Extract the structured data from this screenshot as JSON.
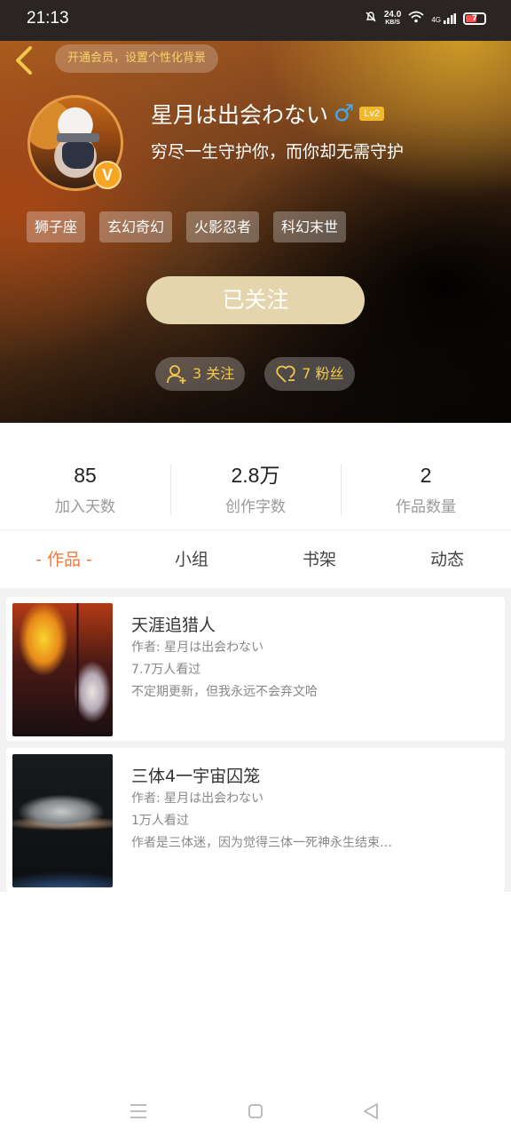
{
  "status_bar": {
    "time": "21:13",
    "speed_value": "24.0",
    "speed_unit": "KB/S",
    "network": "4G",
    "battery": "7"
  },
  "header": {
    "vip_text": "开通会员，设置个性化背景"
  },
  "profile": {
    "username": "星月は出会わない",
    "gender_symbol": "♂",
    "level": "Lv2",
    "verified_mark": "V",
    "signature": "穷尽一生守护你，而你却无需守护",
    "tags": [
      "狮子座",
      "玄幻奇幻",
      "火影忍者",
      "科幻末世"
    ],
    "follow_button": "已关注",
    "following_label": "3 关注",
    "fans_label": "7 粉丝"
  },
  "stats": [
    {
      "value": "85",
      "label": "加入天数"
    },
    {
      "value": "2.8万",
      "label": "创作字数"
    },
    {
      "value": "2",
      "label": "作品数量"
    }
  ],
  "tabs": [
    "- 作品 -",
    "小组",
    "书架",
    "动态"
  ],
  "active_tab": 0,
  "books": [
    {
      "title": "天涯追猎人",
      "author": "作者: 星月は出会わない",
      "views": "7.7万人看过",
      "description": "不定期更新，但我永远不会弃文哈"
    },
    {
      "title": "三体4一宇宙囚笼",
      "author": "作者: 星月は出会わない",
      "views": "1万人看过",
      "description": "作者是三体迷，因为觉得三体一死神永生结束…"
    }
  ],
  "colors": {
    "accent": "#f07a3c",
    "gold": "#f2c94c",
    "follow_button_bg": "#e5d5ad",
    "gender_blue": "#4aa8e8"
  },
  "icons": [
    "back-arrow-icon",
    "person-add-icon",
    "heart-icon",
    "menu-icon",
    "home-square-icon",
    "back-triangle-icon"
  ]
}
